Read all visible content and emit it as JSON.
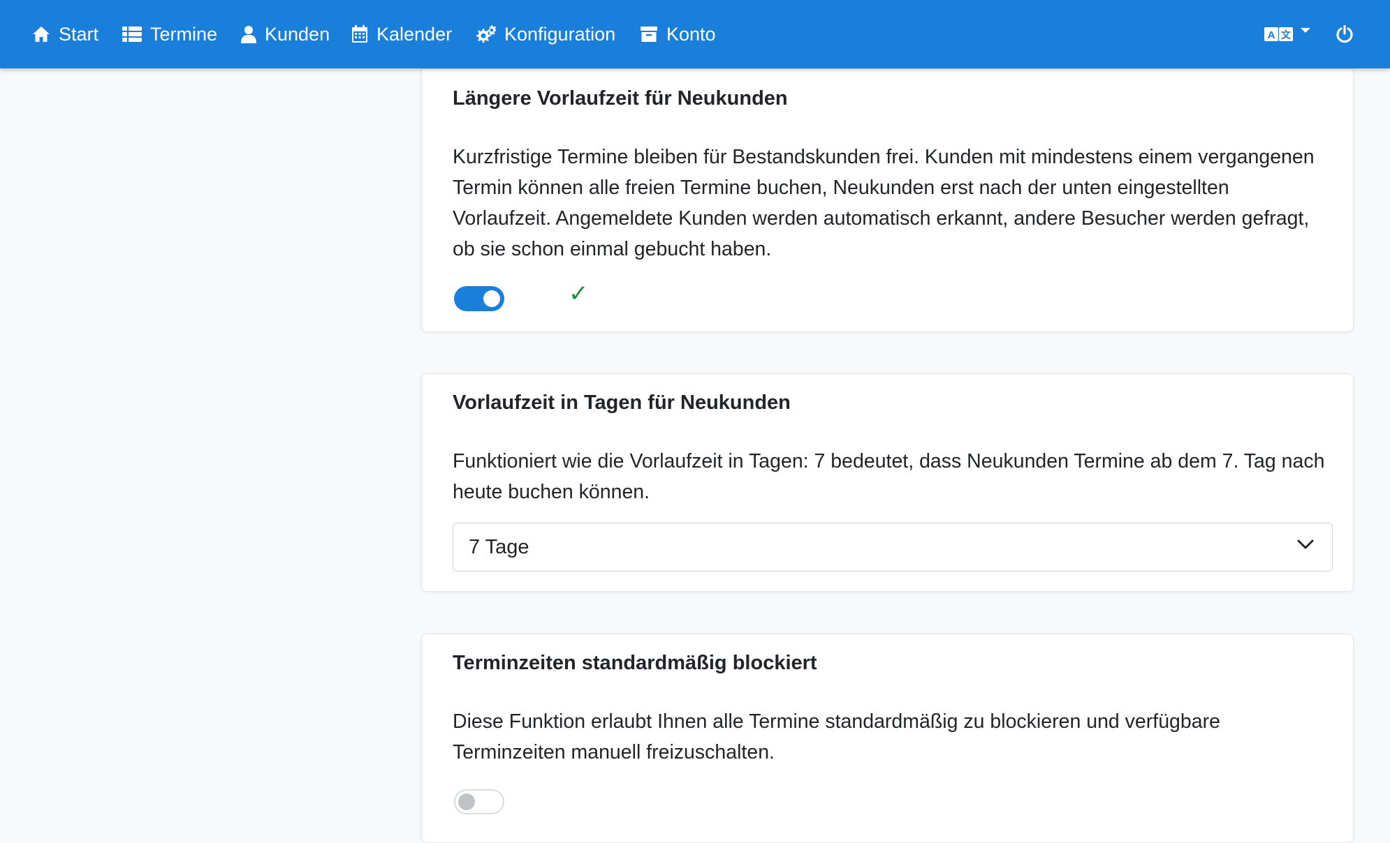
{
  "nav": {
    "items": [
      {
        "label": "Start",
        "icon": "home-icon"
      },
      {
        "label": "Termine",
        "icon": "list-icon"
      },
      {
        "label": "Kunden",
        "icon": "user-icon"
      },
      {
        "label": "Kalender",
        "icon": "calendar-icon"
      },
      {
        "label": "Konfiguration",
        "icon": "gears-icon"
      },
      {
        "label": "Konto",
        "icon": "archive-icon"
      }
    ],
    "right_icons": [
      "language-icon",
      "power-icon"
    ]
  },
  "cards": [
    {
      "title": "Längere Vorlaufzeit für Neukunden",
      "description": "Kurzfristige Termine bleiben für Bestandskunden frei. Kunden mit mindestens einem vergangenen Termin können alle freien Termine buchen, Neukunden erst nach der unten eingestellten Vorlaufzeit. Angemeldete Kunden werden automatisch erkannt, andere Besucher werden gefragt, ob sie schon einmal gebucht haben.",
      "toggle_on": true,
      "saved_mark": "✓"
    },
    {
      "title": "Vorlaufzeit in Tagen für Neukunden",
      "description": "Funktioniert wie die Vorlaufzeit in Tagen: 7 bedeutet, dass Neukunden Termine ab dem 7. Tag nach heute buchen können.",
      "select_value": "7 Tage"
    },
    {
      "title": "Terminzeiten standardmäßig blockiert",
      "description": "Diese Funktion erlaubt Ihnen alle Termine standardmäßig zu blockieren und verfügbare Terminzeiten manuell freizuschalten.",
      "toggle_on": false
    }
  ],
  "colors": {
    "primary": "#1a7fdb",
    "success": "#1e8e3e",
    "background": "#f8f9fa"
  }
}
